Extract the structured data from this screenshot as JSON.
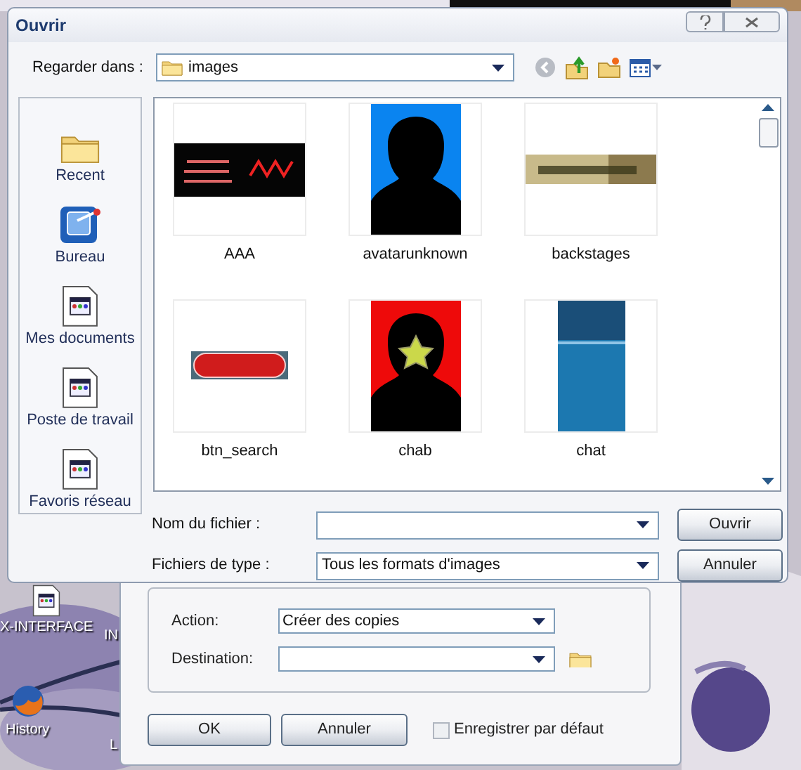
{
  "desktop_icons": [
    {
      "label": "X-INTERFACE",
      "kind": "document"
    },
    {
      "label": "IN",
      "kind": "hidden"
    },
    {
      "label": "History",
      "kind": "browser"
    },
    {
      "label": "L",
      "kind": "hidden"
    }
  ],
  "open_dialog": {
    "title": "Ouvrir",
    "look_in": {
      "label": "Regarder dans :",
      "value": "images"
    },
    "places": [
      {
        "label": "Recent",
        "kind": "folder"
      },
      {
        "label": "Bureau",
        "kind": "desktop"
      },
      {
        "label": "Mes documents",
        "kind": "document"
      },
      {
        "label": "Poste de travail",
        "kind": "document"
      },
      {
        "label": "Favoris réseau",
        "kind": "document"
      }
    ],
    "files": [
      {
        "name": "AAA",
        "kind": "dark-banner"
      },
      {
        "name": "avatarunknown",
        "kind": "blue-avatar"
      },
      {
        "name": "backstages",
        "kind": "light-banner"
      },
      {
        "name": "btn_search",
        "kind": "pill"
      },
      {
        "name": "chab",
        "kind": "red-avatar"
      },
      {
        "name": "chat",
        "kind": "blue-poster"
      }
    ],
    "file_name": {
      "label": "Nom du fichier :"
    },
    "file_type": {
      "label": "Fichiers de type :",
      "value": "Tous les formats d'images"
    },
    "buttons": [
      "Ouvrir",
      "Annuler"
    ]
  },
  "back_dialog": {
    "action": {
      "label": "Action:",
      "value": "Créer des copies"
    },
    "destination": {
      "label": "Destination:"
    },
    "buttons": [
      "OK",
      "Annuler"
    ],
    "save_default": {
      "label": "Enregistrer par défaut",
      "checked": false
    }
  }
}
